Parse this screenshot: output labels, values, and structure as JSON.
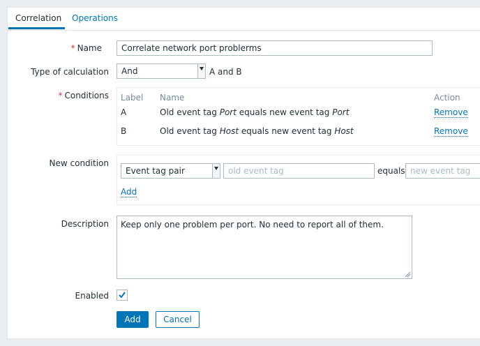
{
  "tabs": [
    {
      "label": "Correlation"
    },
    {
      "label": "Operations"
    }
  ],
  "form": {
    "name_label": "Name",
    "name_value": "Correlate network port problerms",
    "calc_label": "Type of calculation",
    "calc_value": "And",
    "calc_formula": "A and B",
    "conditions_label": "Conditions",
    "conditions_headers": {
      "label": "Label",
      "name": "Name",
      "action": "Action"
    },
    "conditions": [
      {
        "label": "A",
        "prefix": "Old event tag ",
        "tag1": "Port",
        "mid": " equals new event tag ",
        "tag2": "Port",
        "action": "Remove"
      },
      {
        "label": "B",
        "prefix": "Old event tag ",
        "tag1": "Host",
        "mid": " equals new event tag ",
        "tag2": "Host",
        "action": "Remove"
      }
    ],
    "new_condition_label": "New condition",
    "new_condition_type": "Event tag pair",
    "old_tag_placeholder": "old event tag",
    "equals_text": "equals",
    "new_tag_placeholder": "new event tag",
    "add_condition_link": "Add",
    "description_label": "Description",
    "description_value": "Keep only one problem per port. No need to report all of them.",
    "enabled_label": "Enabled",
    "enabled_checked": true,
    "add_button": "Add",
    "cancel_button": "Cancel"
  },
  "colors": {
    "accent": "#0275b8",
    "required": "#e33734",
    "background": "#ebeef0"
  }
}
